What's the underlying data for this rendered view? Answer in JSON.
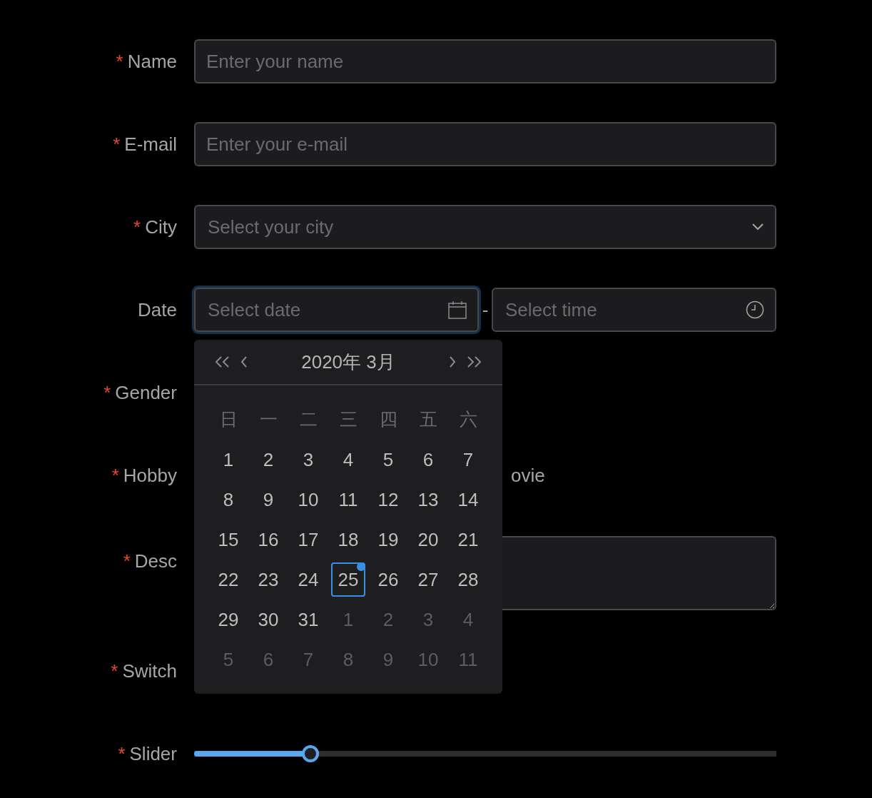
{
  "fields": [
    {
      "kind": "text",
      "label": "Name",
      "required_mark": "*",
      "placeholder": "Enter your name"
    },
    {
      "kind": "text",
      "label": "E-mail",
      "required_mark": "*",
      "placeholder": "Enter your e-mail"
    },
    {
      "kind": "select",
      "label": "City",
      "required_mark": "*",
      "placeholder": "Select your city"
    },
    {
      "kind": "datetime",
      "label": "Date",
      "focused": true,
      "date_placeholder": "Select date",
      "separator": "-",
      "time_placeholder": "Select time"
    },
    {
      "kind": "covered",
      "label": "Gender",
      "required_mark": "*"
    },
    {
      "kind": "partial",
      "label": "Hobby",
      "required_mark": "*",
      "visible_text": "ovie"
    },
    {
      "kind": "textarea",
      "label": "Desc",
      "required_mark": "*"
    },
    {
      "kind": "covered",
      "label": "Switch",
      "required_mark": "*"
    },
    {
      "kind": "slider",
      "label": "Slider",
      "required_mark": "*",
      "level": 0.2
    }
  ],
  "calendar": {
    "title": "2020年 3月",
    "weekdays": [
      "日",
      "一",
      "二",
      "三",
      "四",
      "五",
      "六"
    ],
    "days": [
      {
        "day": "1",
        "in_month": true,
        "selected": false,
        "today": false
      },
      {
        "day": "2",
        "in_month": true,
        "selected": false,
        "today": false
      },
      {
        "day": "3",
        "in_month": true,
        "selected": false,
        "today": false
      },
      {
        "day": "4",
        "in_month": true,
        "selected": false,
        "today": false
      },
      {
        "day": "5",
        "in_month": true,
        "selected": false,
        "today": false
      },
      {
        "day": "6",
        "in_month": true,
        "selected": false,
        "today": false
      },
      {
        "day": "7",
        "in_month": true,
        "selected": false,
        "today": false
      },
      {
        "day": "8",
        "in_month": true,
        "selected": false,
        "today": false
      },
      {
        "day": "9",
        "in_month": true,
        "selected": false,
        "today": false
      },
      {
        "day": "10",
        "in_month": true,
        "selected": false,
        "today": false
      },
      {
        "day": "11",
        "in_month": true,
        "selected": false,
        "today": false
      },
      {
        "day": "12",
        "in_month": true,
        "selected": false,
        "today": false
      },
      {
        "day": "13",
        "in_month": true,
        "selected": false,
        "today": false
      },
      {
        "day": "14",
        "in_month": true,
        "selected": false,
        "today": false
      },
      {
        "day": "15",
        "in_month": true,
        "selected": false,
        "today": false
      },
      {
        "day": "16",
        "in_month": true,
        "selected": false,
        "today": false
      },
      {
        "day": "17",
        "in_month": true,
        "selected": false,
        "today": false
      },
      {
        "day": "18",
        "in_month": true,
        "selected": false,
        "today": false
      },
      {
        "day": "19",
        "in_month": true,
        "selected": false,
        "today": false
      },
      {
        "day": "20",
        "in_month": true,
        "selected": false,
        "today": false
      },
      {
        "day": "21",
        "in_month": true,
        "selected": false,
        "today": false
      },
      {
        "day": "22",
        "in_month": true,
        "selected": false,
        "today": false
      },
      {
        "day": "23",
        "in_month": true,
        "selected": false,
        "today": false
      },
      {
        "day": "24",
        "in_month": true,
        "selected": false,
        "today": false
      },
      {
        "day": "25",
        "in_month": true,
        "selected": true,
        "today": true
      },
      {
        "day": "26",
        "in_month": true,
        "selected": false,
        "today": false
      },
      {
        "day": "27",
        "in_month": true,
        "selected": false,
        "today": false
      },
      {
        "day": "28",
        "in_month": true,
        "selected": false,
        "today": false
      },
      {
        "day": "29",
        "in_month": true,
        "selected": false,
        "today": false
      },
      {
        "day": "30",
        "in_month": true,
        "selected": false,
        "today": false
      },
      {
        "day": "31",
        "in_month": true,
        "selected": false,
        "today": false
      },
      {
        "day": "1",
        "in_month": false,
        "selected": false,
        "today": false
      },
      {
        "day": "2",
        "in_month": false,
        "selected": false,
        "today": false
      },
      {
        "day": "3",
        "in_month": false,
        "selected": false,
        "today": false
      },
      {
        "day": "4",
        "in_month": false,
        "selected": false,
        "today": false
      },
      {
        "day": "5",
        "in_month": false,
        "selected": false,
        "today": false
      },
      {
        "day": "6",
        "in_month": false,
        "selected": false,
        "today": false
      },
      {
        "day": "7",
        "in_month": false,
        "selected": false,
        "today": false
      },
      {
        "day": "8",
        "in_month": false,
        "selected": false,
        "today": false
      },
      {
        "day": "9",
        "in_month": false,
        "selected": false,
        "today": false
      },
      {
        "day": "10",
        "in_month": false,
        "selected": false,
        "today": false
      },
      {
        "day": "11",
        "in_month": false,
        "selected": false,
        "today": false
      }
    ]
  }
}
